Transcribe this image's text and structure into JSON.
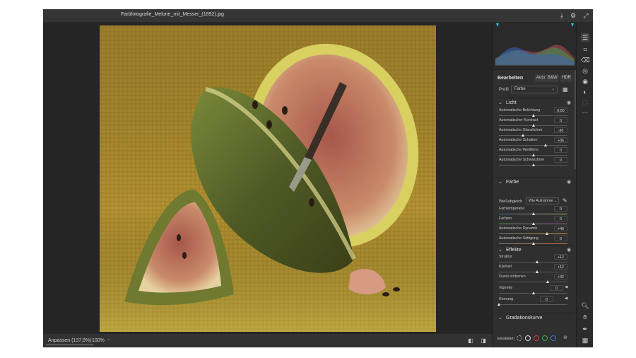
{
  "window": {
    "title": "Farbfotografie_Melone_mit_Messer_(1892).jpg"
  },
  "topbar_icons": [
    "save-icon",
    "gear-icon",
    "expand-icon"
  ],
  "bottombar": {
    "zoom_fit": "Anpassen (137,9%)",
    "zoom_100": "100%"
  },
  "panel": {
    "header": "Bearbeiten",
    "modes": [
      "Auto",
      "B&W",
      "HDR"
    ],
    "profile_label": "Profil",
    "profile_value": "Farbe",
    "sections": {
      "licht": {
        "title": "Licht",
        "sliders": [
          {
            "label": "Automatische Belichtung",
            "value": "0,00",
            "pos": 0.5
          },
          {
            "label": "Automatischer Kontrast",
            "value": "0",
            "pos": 0.5
          },
          {
            "label": "Automatische Glanzlichter",
            "value": "-30",
            "pos": 0.35
          },
          {
            "label": "Automatische Schatten",
            "value": "+36",
            "pos": 0.68
          },
          {
            "label": "Automatische Weißtöne",
            "value": "0",
            "pos": 0.5
          },
          {
            "label": "Automatische Schwarztöne",
            "value": "0",
            "pos": 0.5
          }
        ]
      },
      "farbe": {
        "title": "Farbe",
        "wb_label": "Weißabgleich",
        "wb_value": "Wie Aufnahme",
        "sliders": [
          {
            "label": "Farbtemperatur",
            "value": "0",
            "pos": 0.5
          },
          {
            "label": "Farbton",
            "value": "0",
            "pos": 0.5
          },
          {
            "label": "Automatische Dynamik",
            "value": "+40",
            "pos": 0.7
          },
          {
            "label": "Automatische Sättigung",
            "value": "0",
            "pos": 0.5
          }
        ]
      },
      "effekte": {
        "title": "Effekte",
        "sliders": [
          {
            "label": "Struktur",
            "value": "+12",
            "pos": 0.56
          },
          {
            "label": "Klarheit",
            "value": "+12",
            "pos": 0.56
          },
          {
            "label": "Dunst entfernen",
            "value": "+42",
            "pos": 0.71
          },
          {
            "label": "Vignette",
            "value": "0",
            "pos": 0.5
          },
          {
            "label": "Körnung",
            "value": "0",
            "pos": 0.0
          }
        ]
      },
      "gradation": {
        "title": "Gradationskurve",
        "einstellen_label": "Einstellen"
      }
    }
  },
  "colors": {
    "accent": "#28c8e6",
    "panel": "#2f2f2f",
    "canvas": "#252525"
  }
}
